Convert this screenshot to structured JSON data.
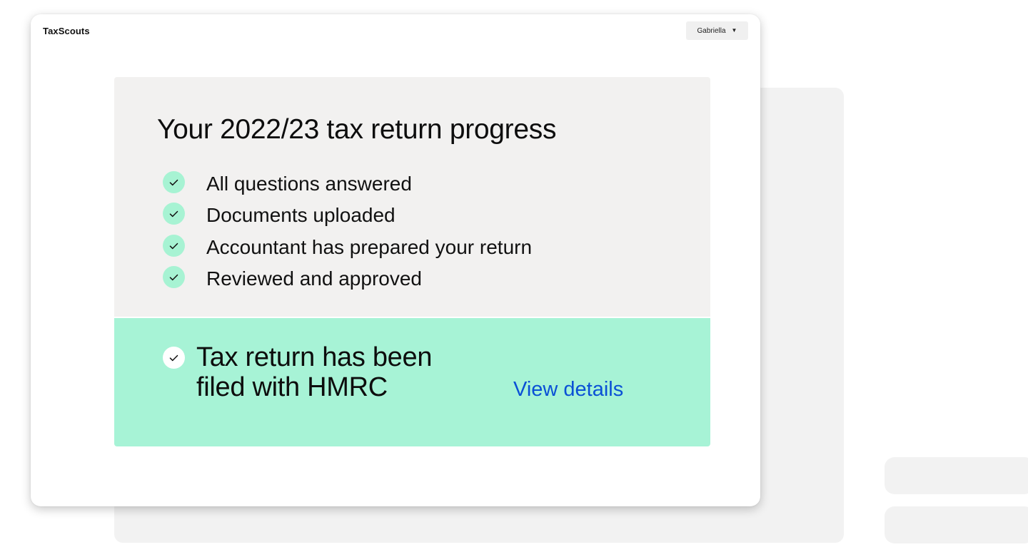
{
  "app": {
    "brand": "TaxScouts",
    "user_name": "Gabriella",
    "user_menu_icon": "caret-down-icon"
  },
  "progress": {
    "title": "Your 2022/23 tax return progress",
    "steps": [
      {
        "label": "All questions answered",
        "icon": "check-icon",
        "status": "complete"
      },
      {
        "label": "Documents uploaded",
        "icon": "check-icon",
        "status": "complete"
      },
      {
        "label": "Accountant has prepared your return",
        "icon": "check-icon",
        "status": "complete"
      },
      {
        "label": "Reviewed and approved",
        "icon": "check-icon",
        "status": "complete"
      }
    ]
  },
  "filed": {
    "title_line1": "Tax return has been",
    "title_line2": "filed with HMRC",
    "icon": "check-icon",
    "link_label": "View details"
  },
  "colors": {
    "accent_mint": "#a7f3d6",
    "panel_grey": "#f2f1f0",
    "link_blue": "#0a50d6"
  }
}
